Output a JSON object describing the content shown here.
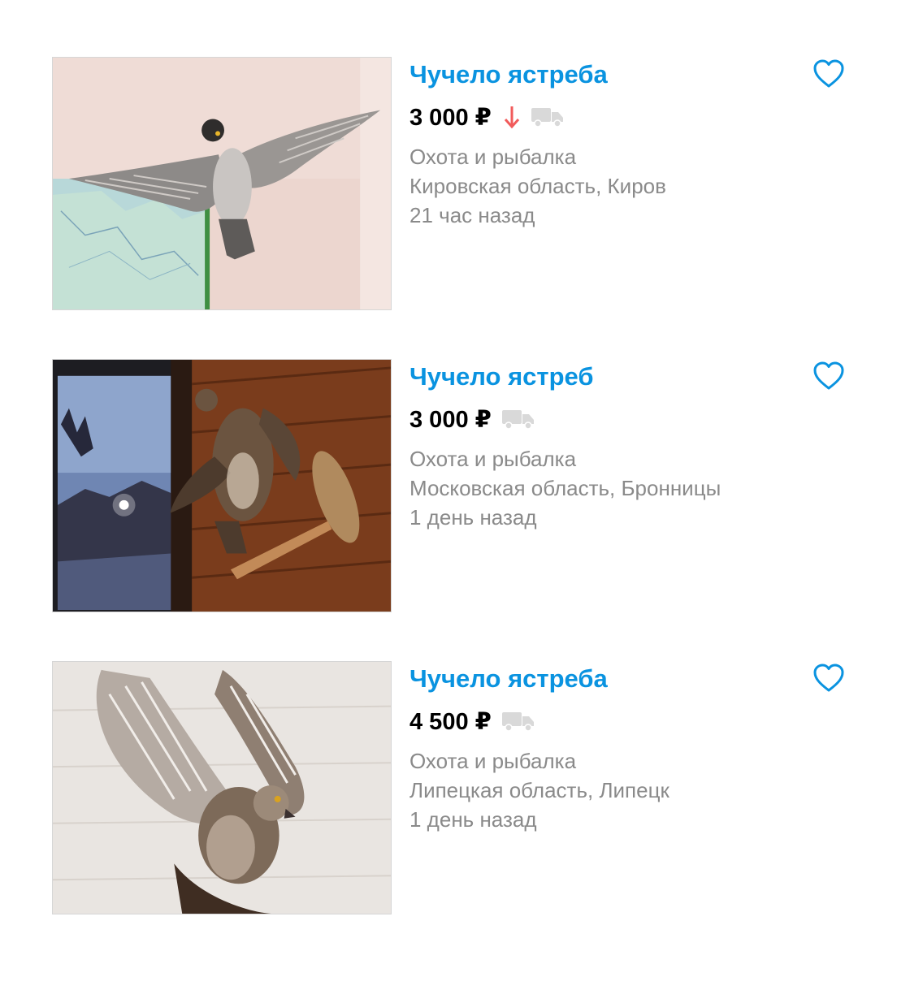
{
  "listings": [
    {
      "title": "Чучело ястреба",
      "price": "3 000 ₽",
      "price_dropped": true,
      "category": "Охота и рыбалка",
      "location": "Кировская область, Киров",
      "posted": "21 час назад"
    },
    {
      "title": "Чучело ястреб",
      "price": "3 000 ₽",
      "price_dropped": false,
      "category": "Охота и рыбалка",
      "location": "Московская область, Бронницы",
      "posted": "1 день назад"
    },
    {
      "title": "Чучело ястреба",
      "price": "4 500 ₽",
      "price_dropped": false,
      "category": "Охота и рыбалка",
      "location": "Липецкая область, Липецк",
      "posted": "1 день назад"
    }
  ],
  "icons": {
    "favorite": "heart-outline-icon",
    "price_drop": "arrow-down-icon",
    "delivery": "delivery-truck-icon"
  },
  "colors": {
    "title": "#0a93e0",
    "price": "#000000",
    "meta": "#8a8a8a",
    "price_drop": "#f15b5b",
    "truck": "#d9d9d9",
    "heart": "#0a93e0"
  }
}
